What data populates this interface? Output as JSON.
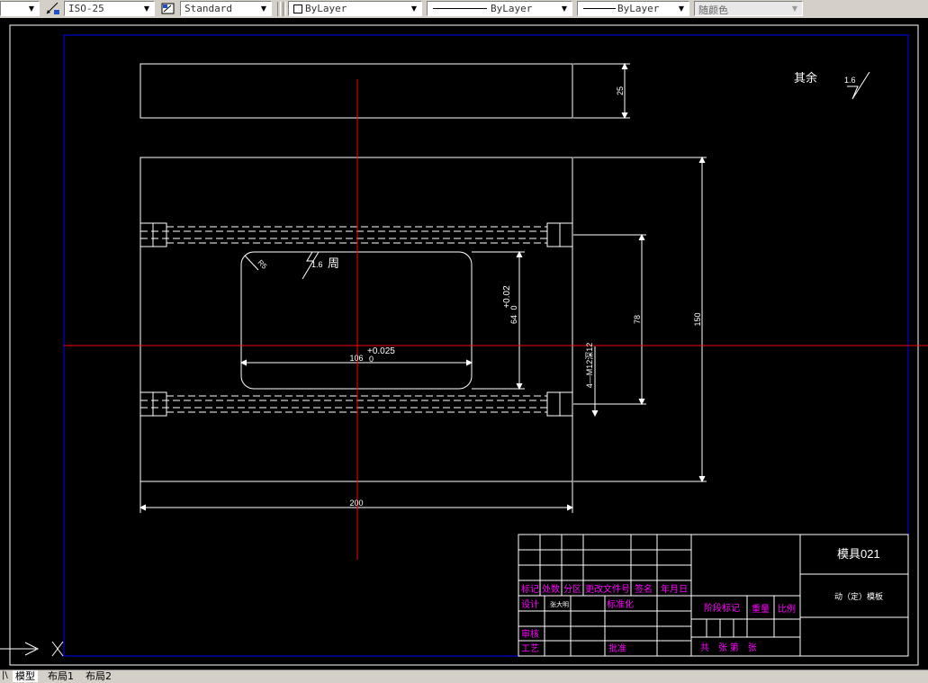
{
  "toolbar": {
    "dimstyle": "ISO-25",
    "textstyle": "Standard",
    "layer_color": "ByLayer",
    "linetype": "ByLayer",
    "lineweight": "ByLayer",
    "plotstyle": "随颜色"
  },
  "drawing": {
    "dim_thickness": "25",
    "dim_width": "200",
    "dim_height": "150",
    "dim_hole_spacing": "78",
    "dim_pocket_width": "106",
    "dim_pocket_width_tol_upper": "+0.025",
    "dim_pocket_width_tol_lower": "0",
    "dim_pocket_height": "64",
    "dim_pocket_height_tol_upper": "+0.02",
    "dim_pocket_height_tol_lower": "0",
    "dim_radius": "R5",
    "thread_note": "4—M12深12",
    "roughness_note_value": "1.6",
    "roughness_note_label": "周",
    "rest_roughness_label": "其余",
    "rest_roughness_value": "1.6",
    "colors": {
      "geometry": "#ffffff",
      "centerline": "#ff0000",
      "border": "#0000ff",
      "titletext": "#ff00ff"
    }
  },
  "title_block": {
    "part_code": "模具021",
    "part_name": "动（定）模板",
    "mark": "标记",
    "count": "处数",
    "zone": "分区",
    "change_doc": "更改文件号",
    "signature": "签名",
    "date": "年月日",
    "design": "设计",
    "design_sig": "张大明",
    "standardize": "标准化",
    "review": "审核",
    "process": "工艺",
    "approve": "批准",
    "stage_mark": "阶段标记",
    "weight": "重量",
    "scale": "比例",
    "sheets": "共　张 第　张"
  },
  "tabs": [
    "模型",
    "布局1",
    "布局2"
  ]
}
